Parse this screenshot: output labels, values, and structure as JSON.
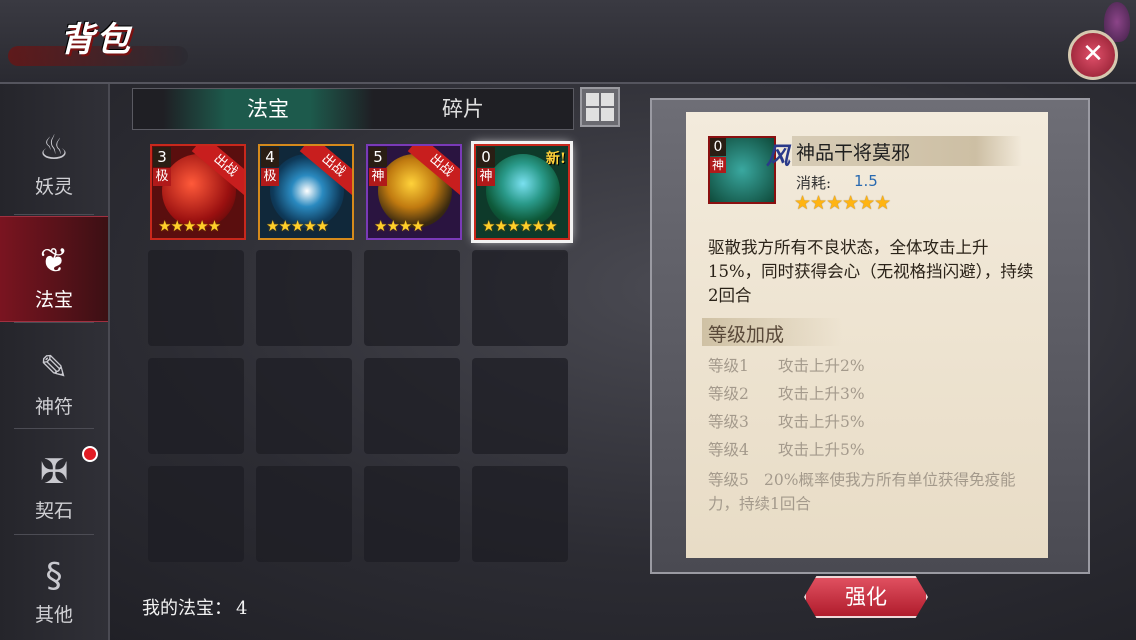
{
  "window": {
    "title": "背包",
    "close_icon": "close-icon"
  },
  "sidebar": {
    "items": [
      {
        "label": "妖灵",
        "icon": "flame-spirit-icon",
        "active": false
      },
      {
        "label": "法宝",
        "icon": "gourd-icon",
        "active": true
      },
      {
        "label": "神符",
        "icon": "talisman-icon",
        "active": false
      },
      {
        "label": "契石",
        "icon": "stone-icon",
        "active": false,
        "badge": true
      },
      {
        "label": "其他",
        "icon": "dragon-icon",
        "active": false
      }
    ]
  },
  "tabs": [
    {
      "label": "法宝",
      "active": true
    },
    {
      "label": "碎片",
      "active": false
    }
  ],
  "items": [
    {
      "count": "3",
      "grade": "极",
      "tag": "出战",
      "stars": "★★★★★",
      "color": "#c8281c"
    },
    {
      "count": "4",
      "grade": "极",
      "tag": "出战",
      "stars": "★★★★★",
      "color": "#d58a1c"
    },
    {
      "count": "5",
      "grade": "神",
      "tag": "出战",
      "stars": "★★★★",
      "color": "#7a3ab8"
    },
    {
      "count": "0",
      "grade": "神",
      "tag": "新!",
      "stars": "★★★★★★",
      "color": "#c8281c"
    }
  ],
  "footer": {
    "label": "我的法宝：",
    "count": "4"
  },
  "detail": {
    "count": "0",
    "grade": "神",
    "element": "风",
    "name": "神品干将莫邪",
    "cost_label": "消耗:",
    "cost_value": "1.5",
    "stars": "★★★★★★",
    "description": "驱散我方所有不良状态，全体攻击上升15%，同时获得会心（无视格挡闪避），持续2回合",
    "section_level": "等级加成",
    "levels": [
      {
        "level": "等级1",
        "effect": "攻击上升2%"
      },
      {
        "level": "等级2",
        "effect": "攻击上升3%"
      },
      {
        "level": "等级3",
        "effect": "攻击上升5%"
      },
      {
        "level": "等级4",
        "effect": "攻击上升5%"
      },
      {
        "level": "等级5",
        "effect": "20%概率使我方所有单位获得免疫能力，持续1回合"
      }
    ],
    "button_label": "强化"
  }
}
